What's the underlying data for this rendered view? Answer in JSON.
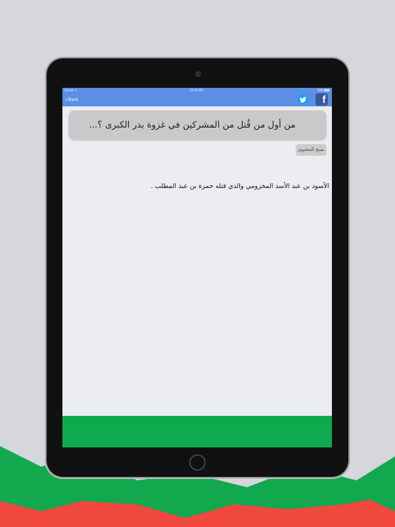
{
  "colors": {
    "background": "#d6d7dc",
    "nav_bar": "#5b8fe6",
    "question_box": "#c9c9cb",
    "footer_green": "#0fa94e",
    "decor_green": "#12a84e",
    "decor_red": "#f0473e"
  },
  "status_bar": {
    "carrier": "Carrier ᯤ",
    "time": "12:52 PM",
    "battery": "80%"
  },
  "nav": {
    "back_label": "Back",
    "back_icon": "chevron-left-icon",
    "share_icons": [
      "twitter-icon",
      "facebook-icon"
    ],
    "facebook_glyph": "f"
  },
  "question": {
    "text": "من أول من قُتل من المشركين في غزوة بدر الكبرى ؟..."
  },
  "copy_button": {
    "label": "نسخ المحتوى"
  },
  "answer": {
    "text": "الأسود بن عبد الأسد المخزومي والذي قتله حمزة بن عبد المطلب ."
  }
}
